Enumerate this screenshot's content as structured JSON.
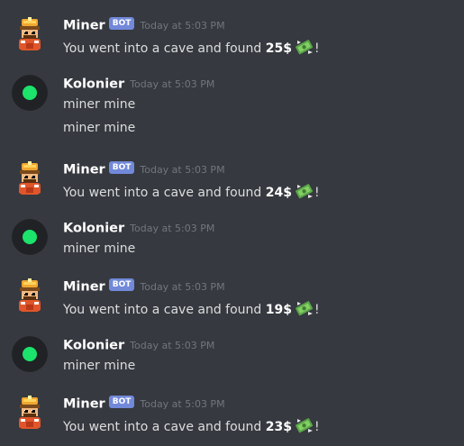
{
  "bot_tag": "BOT",
  "colors": {
    "background": "#36393f",
    "bot_tag": "#7289da",
    "online_green": "#1be36b"
  },
  "messages": [
    {
      "author": "Miner",
      "is_bot": true,
      "avatar_icon": "miner-avatar-icon",
      "timestamp": "Today at 5:03 PM",
      "lines": [
        {
          "before": "You went into a cave and found ",
          "amount": "25$",
          "icon": "money-with-wings-icon",
          "after": "!"
        }
      ]
    },
    {
      "author": "Kolonier",
      "is_bot": false,
      "avatar_icon": "kolonier-avatar-icon",
      "timestamp": "Today at 5:03 PM",
      "lines": [
        {
          "text": "miner mine"
        },
        {
          "text": "miner mine"
        }
      ]
    },
    {
      "author": "Miner",
      "is_bot": true,
      "avatar_icon": "miner-avatar-icon",
      "timestamp": "Today at 5:03 PM",
      "lines": [
        {
          "before": "You went into a cave and found ",
          "amount": "24$",
          "icon": "money-with-wings-icon",
          "after": "!"
        }
      ]
    },
    {
      "author": "Kolonier",
      "is_bot": false,
      "avatar_icon": "kolonier-avatar-icon",
      "timestamp": "Today at 5:03 PM",
      "lines": [
        {
          "text": "miner mine"
        }
      ]
    },
    {
      "author": "Miner",
      "is_bot": true,
      "avatar_icon": "miner-avatar-icon",
      "timestamp": "Today at 5:03 PM",
      "lines": [
        {
          "before": "You went into a cave and found ",
          "amount": "19$",
          "icon": "money-with-wings-icon",
          "after": "!"
        }
      ]
    },
    {
      "author": "Kolonier",
      "is_bot": false,
      "avatar_icon": "kolonier-avatar-icon",
      "timestamp": "Today at 5:03 PM",
      "lines": [
        {
          "text": "miner mine"
        }
      ]
    },
    {
      "author": "Miner",
      "is_bot": true,
      "avatar_icon": "miner-avatar-icon",
      "timestamp": "Today at 5:03 PM",
      "lines": [
        {
          "before": "You went into a cave and found ",
          "amount": "23$",
          "icon": "money-with-wings-icon",
          "after": "!"
        }
      ]
    }
  ]
}
